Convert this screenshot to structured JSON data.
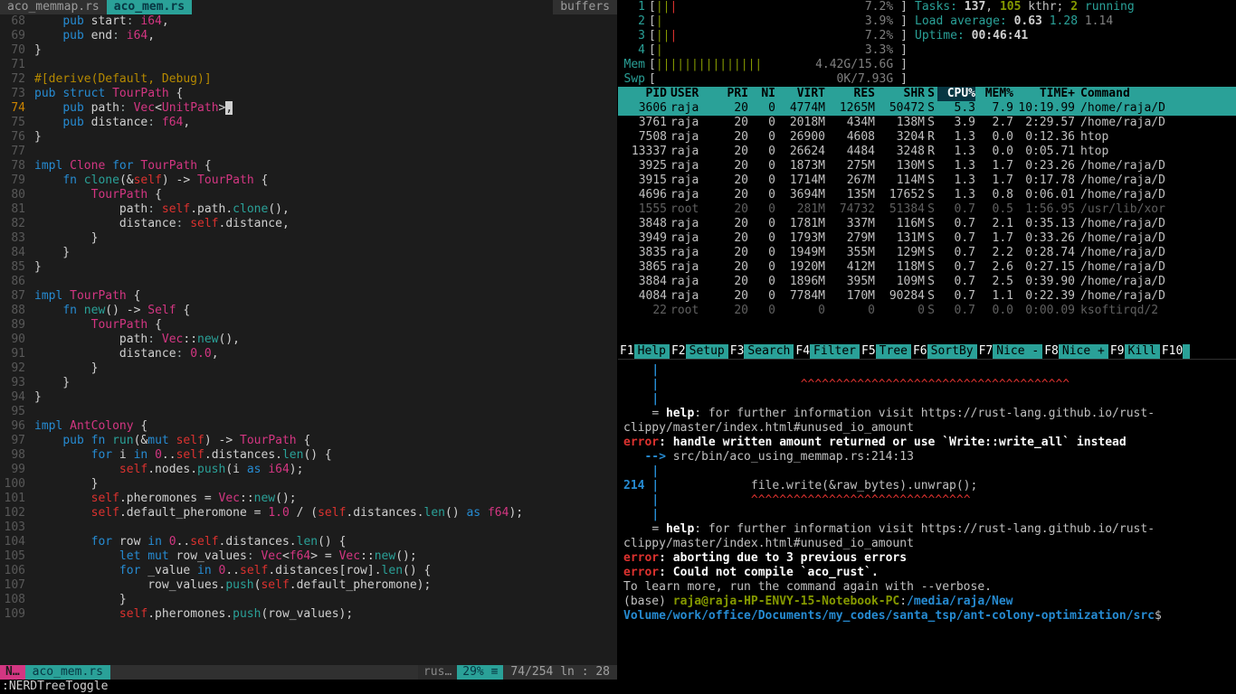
{
  "editor": {
    "tabs": [
      {
        "label": "aco_memmap.rs",
        "active": false
      },
      {
        "label": "aco_mem.rs",
        "active": true
      }
    ],
    "buffers_label": "buffers",
    "lines": [
      {
        "n": 68,
        "html": "    <span class='kw'>pub</span> start<span class='pun'>:</span> <span class='ty'>i64</span>,"
      },
      {
        "n": 69,
        "html": "    <span class='kw'>pub</span> end<span class='pun'>:</span> <span class='ty'>i64</span>,"
      },
      {
        "n": 70,
        "html": "}"
      },
      {
        "n": 71,
        "html": ""
      },
      {
        "n": 72,
        "html": "<span class='attr'>#[derive(Default, Debug)]</span>"
      },
      {
        "n": 73,
        "html": "<span class='kw'>pub</span> <span class='kw'>struct</span> <span class='ty'>TourPath</span> {"
      },
      {
        "n": 74,
        "cur": true,
        "html": "    <span class='kw'>pub</span> path<span class='pun'>:</span> <span class='ty'>Vec</span>&lt;<span class='ty'>UnitPath</span>&gt;<span class='cursor'>,</span>"
      },
      {
        "n": 75,
        "html": "    <span class='kw'>pub</span> distance<span class='pun'>:</span> <span class='ty'>f64</span>,"
      },
      {
        "n": 76,
        "html": "}"
      },
      {
        "n": 77,
        "html": ""
      },
      {
        "n": 78,
        "html": "<span class='kw'>impl</span> <span class='ty'>Clone</span> <span class='kw'>for</span> <span class='ty'>TourPath</span> {"
      },
      {
        "n": 79,
        "html": "    <span class='kw'>fn</span> <span class='fnname'>clone</span>(&amp;<span class='self'>self</span>) -&gt; <span class='ty'>TourPath</span> {"
      },
      {
        "n": 80,
        "html": "        <span class='ty'>TourPath</span> {"
      },
      {
        "n": 81,
        "html": "            path<span class='pun'>:</span> <span class='self'>self</span>.path.<span class='fnname'>clone</span>(),"
      },
      {
        "n": 82,
        "html": "            distance<span class='pun'>:</span> <span class='self'>self</span>.distance,"
      },
      {
        "n": 83,
        "html": "        }"
      },
      {
        "n": 84,
        "html": "    }"
      },
      {
        "n": 85,
        "html": "}"
      },
      {
        "n": 86,
        "html": ""
      },
      {
        "n": 87,
        "html": "<span class='kw'>impl</span> <span class='ty'>TourPath</span> {"
      },
      {
        "n": 88,
        "html": "    <span class='kw'>fn</span> <span class='fnname'>new</span>() -&gt; <span class='ty'>Self</span> {"
      },
      {
        "n": 89,
        "html": "        <span class='ty'>TourPath</span> {"
      },
      {
        "n": 90,
        "html": "            path<span class='pun'>:</span> <span class='ty'>Vec</span>::<span class='fnname'>new</span>(),"
      },
      {
        "n": 91,
        "html": "            distance<span class='pun'>:</span> <span class='num'>0.0</span>,"
      },
      {
        "n": 92,
        "html": "        }"
      },
      {
        "n": 93,
        "html": "    }"
      },
      {
        "n": 94,
        "html": "}"
      },
      {
        "n": 95,
        "html": ""
      },
      {
        "n": 96,
        "html": "<span class='kw'>impl</span> <span class='ty'>AntColony</span> {"
      },
      {
        "n": 97,
        "html": "    <span class='kw'>pub</span> <span class='kw'>fn</span> <span class='fnname'>run</span>(&amp;<span class='kw'>mut</span> <span class='self'>self</span>) -&gt; <span class='ty'>TourPath</span> {"
      },
      {
        "n": 98,
        "html": "        <span class='kw'>for</span> i <span class='kw'>in</span> <span class='num'>0</span>..<span class='self'>self</span>.distances.<span class='fnname'>len</span>() {"
      },
      {
        "n": 99,
        "html": "            <span class='self'>self</span>.nodes.<span class='fnname'>push</span>(i <span class='kw'>as</span> <span class='ty'>i64</span>);"
      },
      {
        "n": 100,
        "html": "        }"
      },
      {
        "n": 101,
        "html": "        <span class='self'>self</span>.pheromones = <span class='ty'>Vec</span>::<span class='fnname'>new</span>();"
      },
      {
        "n": 102,
        "html": "        <span class='self'>self</span>.default_pheromone = <span class='num'>1.0</span> / (<span class='self'>self</span>.distances.<span class='fnname'>len</span>() <span class='kw'>as</span> <span class='ty'>f64</span>);"
      },
      {
        "n": 103,
        "html": ""
      },
      {
        "n": 104,
        "html": "        <span class='kw'>for</span> row <span class='kw'>in</span> <span class='num'>0</span>..<span class='self'>self</span>.distances.<span class='fnname'>len</span>() {"
      },
      {
        "n": 105,
        "html": "            <span class='kw'>let</span> <span class='kw'>mut</span> row_values<span class='pun'>:</span> <span class='ty'>Vec</span>&lt;<span class='ty'>f64</span>&gt; = <span class='ty'>Vec</span>::<span class='fnname'>new</span>();"
      },
      {
        "n": 106,
        "html": "            <span class='kw'>for</span> _value <span class='kw'>in</span> <span class='num'>0</span>..<span class='self'>self</span>.distances[row].<span class='fnname'>len</span>() {"
      },
      {
        "n": 107,
        "html": "                row_values.<span class='fnname'>push</span>(<span class='self'>self</span>.default_pheromone);"
      },
      {
        "n": 108,
        "html": "            }"
      },
      {
        "n": 109,
        "html": "            <span class='self'>self</span>.pheromones.<span class='fnname'>push</span>(row_values);"
      }
    ],
    "status": {
      "mode": "N…",
      "file": "aco_mem.rs",
      "filetype": "rus…",
      "percent": "29% ≡",
      "pos": "74/254 ln : 28"
    },
    "cmd": ":NERDTreeToggle"
  },
  "htop": {
    "cpus": [
      {
        "n": "1",
        "bars": "||",
        "r": "|",
        "pct": "7.2%"
      },
      {
        "n": "2",
        "bars": "|",
        "r": "",
        "pct": "3.9%"
      },
      {
        "n": "3",
        "bars": "||",
        "r": "|",
        "pct": "7.2%"
      },
      {
        "n": "4",
        "bars": "|",
        "r": "",
        "pct": "3.3%"
      }
    ],
    "mem": {
      "label": "Mem",
      "bars": "|||||||||||||||",
      "val": "4.42G/15.6G"
    },
    "swp": {
      "label": "Swp",
      "bars": "",
      "val": "0K/7.93G"
    },
    "tasks": "Tasks: 137, 105 kthr; 2 running",
    "tasks_parts": {
      "a": "Tasks: ",
      "b": "137",
      "c": ", ",
      "d": "105",
      "e": " kthr; ",
      "f": "2",
      "g": " running"
    },
    "load": "Load average: 0.63 1.28 1.14",
    "load_parts": {
      "a": "Load average: ",
      "b": "0.63",
      "c": " 1.28",
      "d": " 1.14"
    },
    "uptime": "Uptime: 00:46:41",
    "uptime_parts": {
      "a": "Uptime: ",
      "b": "00:46:41"
    },
    "columns": [
      "PID",
      "USER",
      "PRI",
      "NI",
      "VIRT",
      "RES",
      "SHR",
      "S",
      "CPU%",
      "MEM%",
      "TIME+",
      "Command"
    ],
    "rows": [
      {
        "pid": "3606",
        "user": "raja",
        "pri": "20",
        "ni": "0",
        "virt": "4774M",
        "res": "1265M",
        "shr": "50472",
        "s": "S",
        "cpu": "5.3",
        "mem": "7.9",
        "time": "10:19.99",
        "cmd": "/home/raja/D",
        "sel": true
      },
      {
        "pid": "3761",
        "user": "raja",
        "pri": "20",
        "ni": "0",
        "virt": "2018M",
        "res": "434M",
        "shr": "138M",
        "s": "S",
        "cpu": "3.9",
        "mem": "2.7",
        "time": "2:29.57",
        "cmd": "/home/raja/D"
      },
      {
        "pid": "7508",
        "user": "raja",
        "pri": "20",
        "ni": "0",
        "virt": "26900",
        "res": "4608",
        "shr": "3204",
        "s": "R",
        "cpu": "1.3",
        "mem": "0.0",
        "time": "0:12.36",
        "cmd": "htop"
      },
      {
        "pid": "13337",
        "user": "raja",
        "pri": "20",
        "ni": "0",
        "virt": "26624",
        "res": "4484",
        "shr": "3248",
        "s": "R",
        "cpu": "1.3",
        "mem": "0.0",
        "time": "0:05.71",
        "cmd": "htop"
      },
      {
        "pid": "3925",
        "user": "raja",
        "pri": "20",
        "ni": "0",
        "virt": "1873M",
        "res": "275M",
        "shr": "130M",
        "s": "S",
        "cpu": "1.3",
        "mem": "1.7",
        "time": "0:23.26",
        "cmd": "/home/raja/D"
      },
      {
        "pid": "3915",
        "user": "raja",
        "pri": "20",
        "ni": "0",
        "virt": "1714M",
        "res": "267M",
        "shr": "114M",
        "s": "S",
        "cpu": "1.3",
        "mem": "1.7",
        "time": "0:17.78",
        "cmd": "/home/raja/D"
      },
      {
        "pid": "4696",
        "user": "raja",
        "pri": "20",
        "ni": "0",
        "virt": "3694M",
        "res": "135M",
        "shr": "17652",
        "s": "S",
        "cpu": "1.3",
        "mem": "0.8",
        "time": "0:06.01",
        "cmd": "/home/raja/D"
      },
      {
        "pid": "1555",
        "user": "root",
        "pri": "20",
        "ni": "0",
        "virt": "281M",
        "res": "74732",
        "shr": "51384",
        "s": "S",
        "cpu": "0.7",
        "mem": "0.5",
        "time": "1:56.95",
        "cmd": "/usr/lib/xor",
        "dim": true
      },
      {
        "pid": "3848",
        "user": "raja",
        "pri": "20",
        "ni": "0",
        "virt": "1781M",
        "res": "337M",
        "shr": "116M",
        "s": "S",
        "cpu": "0.7",
        "mem": "2.1",
        "time": "0:35.13",
        "cmd": "/home/raja/D"
      },
      {
        "pid": "3949",
        "user": "raja",
        "pri": "20",
        "ni": "0",
        "virt": "1793M",
        "res": "279M",
        "shr": "131M",
        "s": "S",
        "cpu": "0.7",
        "mem": "1.7",
        "time": "0:33.26",
        "cmd": "/home/raja/D"
      },
      {
        "pid": "3835",
        "user": "raja",
        "pri": "20",
        "ni": "0",
        "virt": "1949M",
        "res": "355M",
        "shr": "129M",
        "s": "S",
        "cpu": "0.7",
        "mem": "2.2",
        "time": "0:28.74",
        "cmd": "/home/raja/D"
      },
      {
        "pid": "3865",
        "user": "raja",
        "pri": "20",
        "ni": "0",
        "virt": "1920M",
        "res": "412M",
        "shr": "118M",
        "s": "S",
        "cpu": "0.7",
        "mem": "2.6",
        "time": "0:27.15",
        "cmd": "/home/raja/D"
      },
      {
        "pid": "3884",
        "user": "raja",
        "pri": "20",
        "ni": "0",
        "virt": "1896M",
        "res": "395M",
        "shr": "109M",
        "s": "S",
        "cpu": "0.7",
        "mem": "2.5",
        "time": "0:39.90",
        "cmd": "/home/raja/D"
      },
      {
        "pid": "4084",
        "user": "raja",
        "pri": "20",
        "ni": "0",
        "virt": "7784M",
        "res": "170M",
        "shr": "90284",
        "s": "S",
        "cpu": "0.7",
        "mem": "1.1",
        "time": "0:22.39",
        "cmd": "/home/raja/D"
      },
      {
        "pid": "22",
        "user": "root",
        "pri": "20",
        "ni": "0",
        "virt": "0",
        "res": "0",
        "shr": "0",
        "s": "S",
        "cpu": "0.7",
        "mem": "0.0",
        "time": "0:00.09",
        "cmd": "ksoftirqd/2",
        "dim": true
      }
    ],
    "fkeys": [
      {
        "k": "F1",
        "l": "Help"
      },
      {
        "k": "F2",
        "l": "Setup"
      },
      {
        "k": "F3",
        "l": "Search"
      },
      {
        "k": "F4",
        "l": "Filter"
      },
      {
        "k": "F5",
        "l": "Tree"
      },
      {
        "k": "F6",
        "l": "SortBy"
      },
      {
        "k": "F7",
        "l": "Nice -"
      },
      {
        "k": "F8",
        "l": "Nice +"
      },
      {
        "k": "F9",
        "l": "Kill"
      },
      {
        "k": "F10",
        "l": ""
      }
    ]
  },
  "term": {
    "lines": [
      "    <span class='blu'>|</span>",
      "    <span class='blu'>|</span>                    <span class='caret'>^^^^^^^^^^^^^^^^^^^^^^^^^^^^^^^^^^^^^^</span>",
      "    <span class='blu'>|</span>",
      "    = <span class='wht'>help</span>: for further information visit https://rust-lang.github.io/rust-clippy/master/index.html#unused_io_amount",
      "",
      "<span class='red'>error</span><span class='wht'>: handle written amount returned or use `Write::write_all` instead</span>",
      "   <span class='blu'>--&gt;</span> src/bin/aco_using_memmap.rs:214:13",
      "    <span class='blu'>|</span>",
      "<span class='blu'>214</span> <span class='blu'>|</span>             file.write(&amp;raw_bytes).unwrap();",
      "    <span class='blu'>|</span>             <span class='caret'>^^^^^^^^^^^^^^^^^^^^^^^^^^^^^^^</span>",
      "    <span class='blu'>|</span>",
      "    = <span class='wht'>help</span>: for further information visit https://rust-lang.github.io/rust-clippy/master/index.html#unused_io_amount",
      "",
      "<span class='red'>error</span><span class='wht'>: aborting due to 3 previous errors</span>",
      "",
      "<span class='red'>error</span><span class='wht'>: Could not compile `aco_rust`.</span>",
      "",
      "To learn more, run the command again with --verbose.",
      "(base) <span class='prompt-user'>raja@raja-HP-ENVY-15-Notebook-PC</span>:<span class='prompt-path'>/media/raja/New Volume/work/office/Documents/my_codes/santa_tsp/ant-colony-optimization/src</span>$"
    ]
  }
}
